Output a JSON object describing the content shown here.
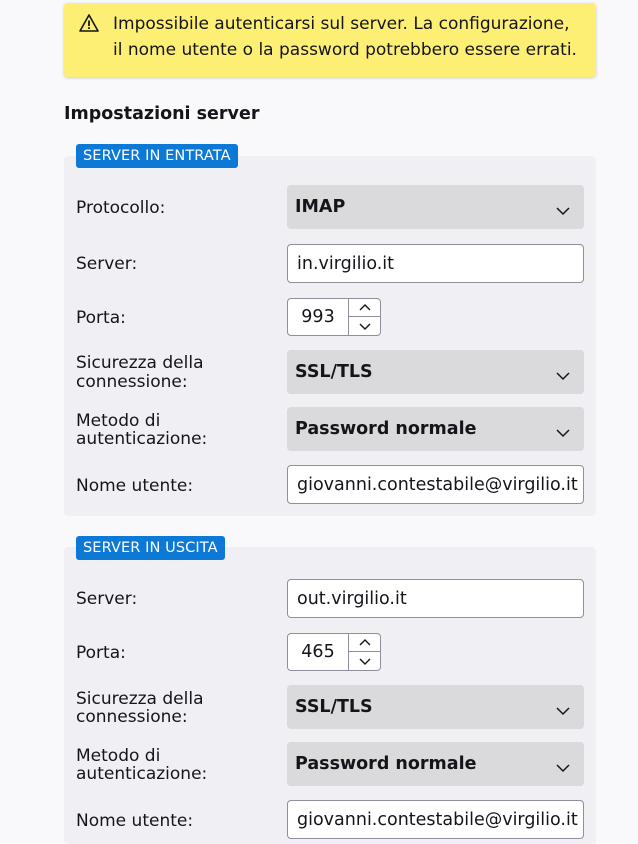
{
  "notice": {
    "icon": "warning-icon",
    "message": "Impossibile autenticarsi sul server. La configurazione, il nome utente o la password potrebbero essere errati."
  },
  "section_title": "Impostazioni server",
  "incoming": {
    "legend": "SERVER IN ENTRATA",
    "protocol_label": "Protocollo:",
    "protocol_value": "IMAP",
    "server_label": "Server:",
    "server_value": "in.virgilio.it",
    "port_label": "Porta:",
    "port_value": "993",
    "security_label_1": "Sicurezza della",
    "security_label_2": "connessione:",
    "security_value": "SSL/TLS",
    "auth_label_1": "Metodo di",
    "auth_label_2": "autenticazione:",
    "auth_value": "Password normale",
    "username_label": "Nome utente:",
    "username_value": "giovanni.contestabile@virgilio.it"
  },
  "outgoing": {
    "legend": "SERVER IN USCITA",
    "server_label": "Server:",
    "server_value": "out.virgilio.it",
    "port_label": "Porta:",
    "port_value": "465",
    "security_label_1": "Sicurezza della",
    "security_label_2": "connessione:",
    "security_value": "SSL/TLS",
    "auth_label_1": "Metodo di",
    "auth_label_2": "autenticazione:",
    "auth_value": "Password normale",
    "username_label": "Nome utente:",
    "username_value": "giovanni.contestabile@virgilio.it"
  },
  "colors": {
    "notice_bg": "#fcef74",
    "legend_bg": "#0c79d6",
    "panel_bg": "#f0f0f4",
    "select_bg": "#dadadd"
  }
}
